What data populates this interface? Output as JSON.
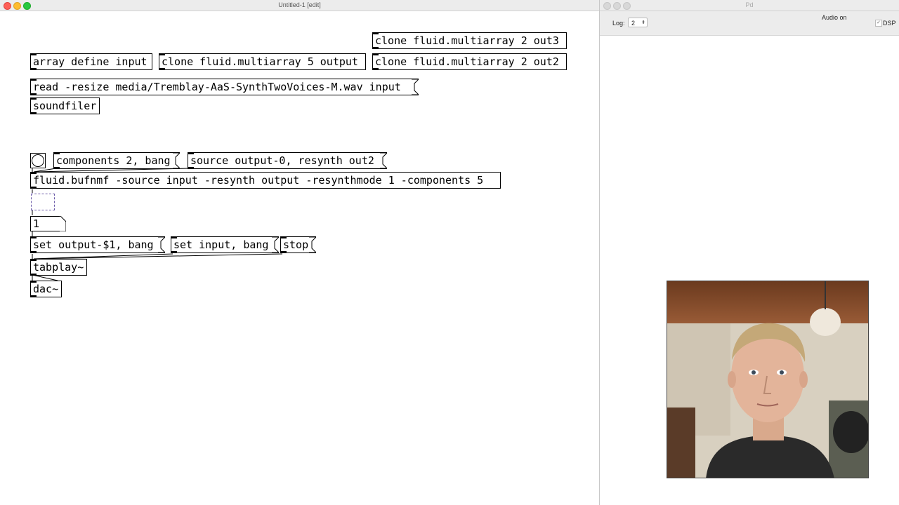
{
  "patch_window": {
    "title": "Untitled-1 [edit]",
    "objects": {
      "clone_out3": "clone fluid.multiarray 2 out3",
      "array_define": "array define input",
      "clone_output": "clone fluid.multiarray 5 output",
      "clone_out2": "clone fluid.multiarray 2 out2",
      "soundfiler": "soundfiler",
      "bufnmf": "fluid.bufnmf -source input -resynth output -resynthmode 1 -components 5",
      "tabplay": "tabplay~",
      "dac": "dac~"
    },
    "messages": {
      "read": "read -resize media/Tremblay-AaS-SynthTwoVoices-M.wav input",
      "components": "components 2, bang",
      "source": "source output-0, resynth out2",
      "set_output": "set output-$1, bang",
      "set_input": "set input, bang",
      "stop": "stop"
    },
    "number_box_value": "1"
  },
  "console_window": {
    "title": "Pd",
    "log_label": "Log:",
    "log_level": "2",
    "audio_status": "Audio on",
    "dsp_label": "DSP",
    "dsp_checked": true
  },
  "colors": {
    "edit_placeholder": "#6a5aa8",
    "toolbar_bg": "#ececec"
  }
}
